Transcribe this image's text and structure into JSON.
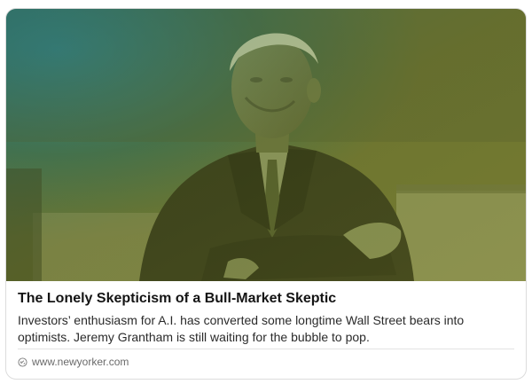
{
  "preview": {
    "image_alt": "Jeremy Grantham speaking with arms crossed",
    "title": "The Lonely Skepticism of a Bull-Market Skeptic",
    "description": "Investors’ enthusiasm for A.I. has converted some longtime Wall Street bears into optimists. Jeremy Grantham is still waiting for the bubble to pop.",
    "source_icon": "link-icon",
    "source_domain": "www.newyorker.com"
  },
  "colors": {
    "tint_green": "#6e7a2c",
    "tint_teal": "#1f5f6b",
    "title": "#141414",
    "text": "#2b2b2b",
    "muted": "#6a6a6a"
  }
}
